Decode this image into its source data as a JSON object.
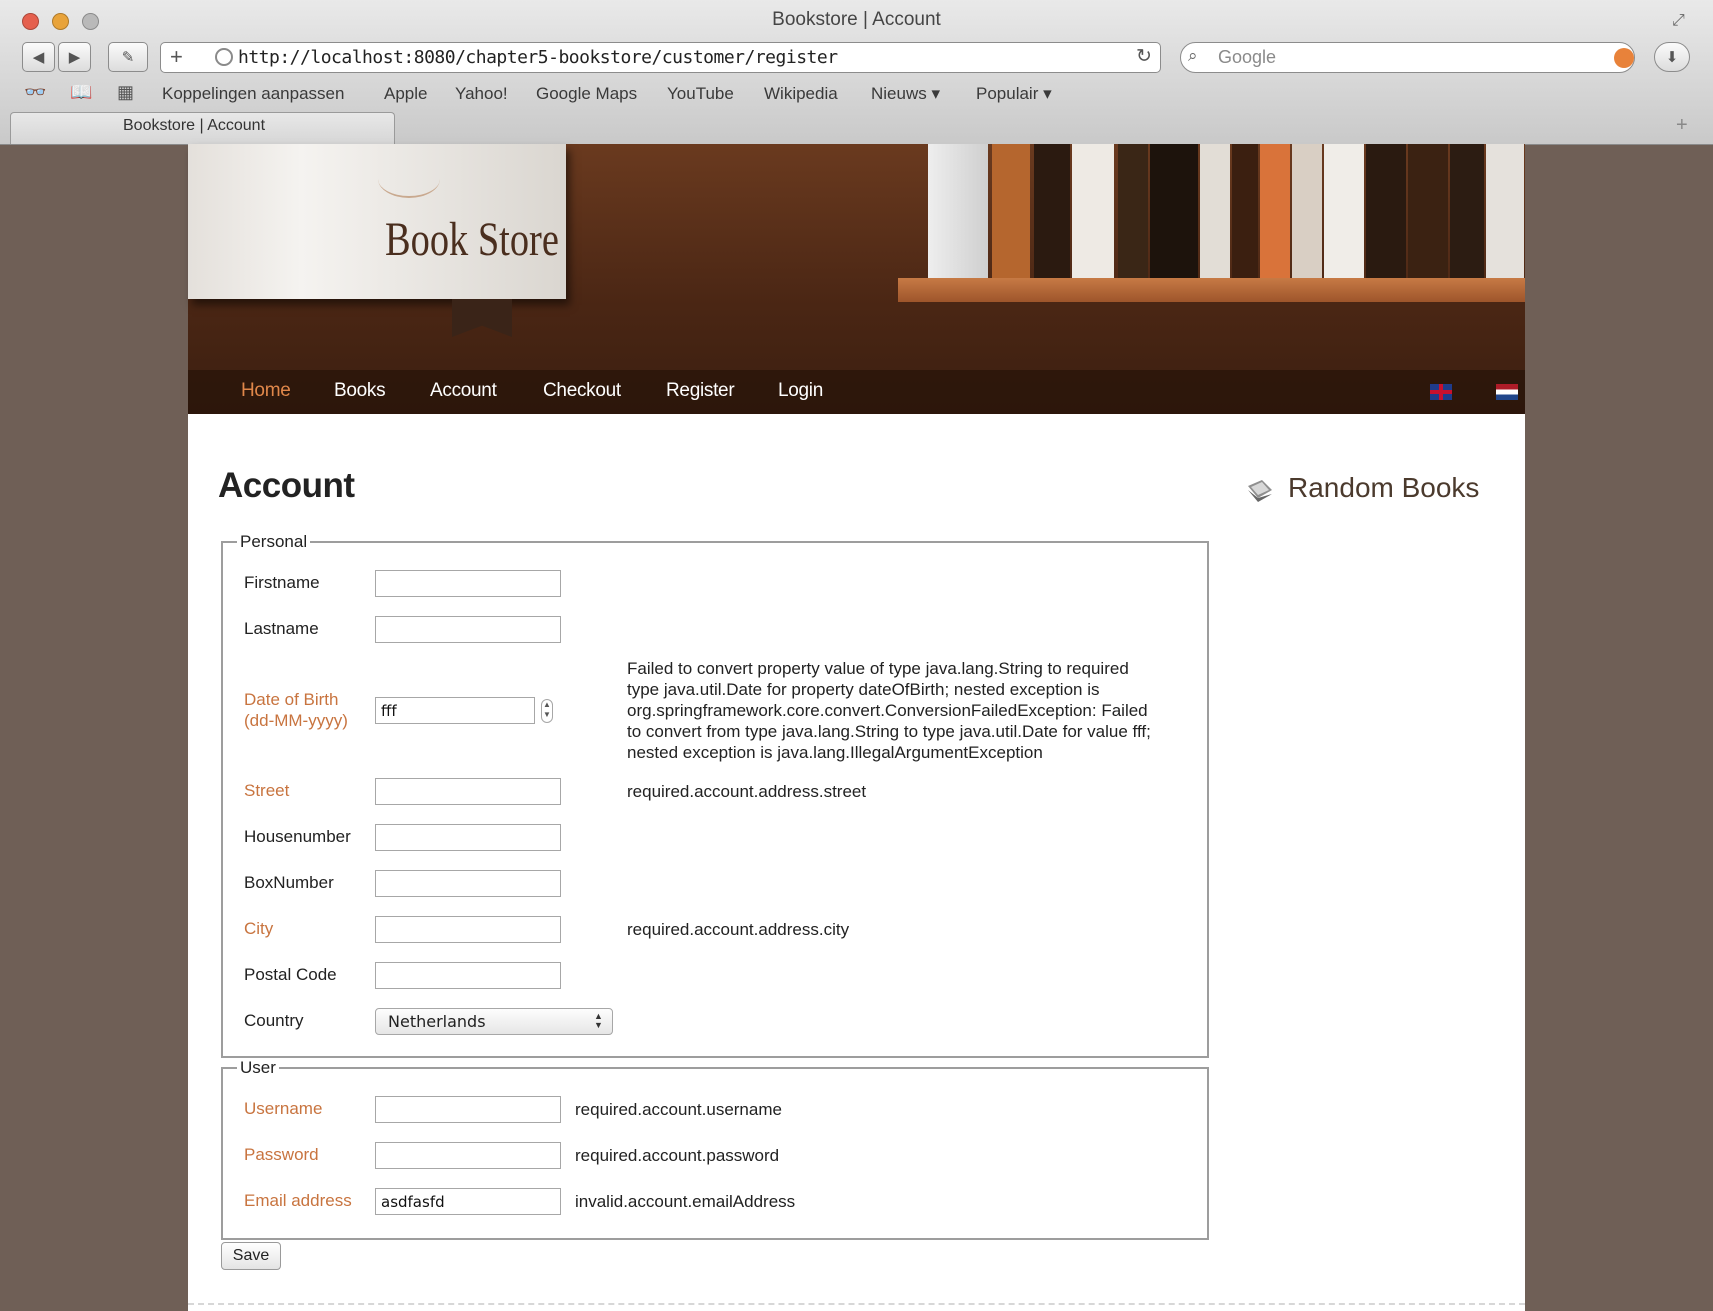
{
  "browser": {
    "window_title": "Bookstore | Account",
    "url": "http://localhost:8080/chapter5-bookstore/customer/register",
    "search_placeholder": "Google",
    "tab_title": "Bookstore | Account",
    "add_tab_label": "+",
    "new_button_label": "+",
    "bookmarks": [
      "Koppelingen aanpassen",
      "Apple",
      "Yahoo!",
      "Google Maps",
      "YouTube",
      "Wikipedia",
      "Nieuws ▾",
      "Populair ▾"
    ]
  },
  "header": {
    "logo": "Book Store"
  },
  "nav": {
    "items": [
      "Home",
      "Books",
      "Account",
      "Checkout",
      "Register",
      "Login"
    ],
    "active": "Home"
  },
  "page": {
    "title": "Account"
  },
  "sidebar": {
    "title": "Random Books"
  },
  "form": {
    "personal": {
      "legend": "Personal",
      "firstname_label": "Firstname",
      "lastname_label": "Lastname",
      "dob_label_1": "Date of Birth",
      "dob_label_2": "(dd-MM-yyyy)",
      "dob_value": "fff",
      "dob_error": [
        "Failed to convert property value of type java.lang.String to required",
        "type java.util.Date for property dateOfBirth; nested exception is",
        "org.springframework.core.convert.ConversionFailedException: Failed",
        "to convert from type java.lang.String to type java.util.Date for value fff;",
        "nested exception is java.lang.IllegalArgumentException"
      ],
      "street_label": "Street",
      "street_error": "required.account.address.street",
      "housenumber_label": "Housenumber",
      "boxnumber_label": "BoxNumber",
      "city_label": "City",
      "city_error": "required.account.address.city",
      "postal_label": "Postal Code",
      "country_label": "Country",
      "country_value": "Netherlands"
    },
    "user": {
      "legend": "User",
      "username_label": "Username",
      "username_error": "required.account.username",
      "password_label": "Password",
      "password_error": "required.account.password",
      "email_label": "Email address",
      "email_value": "asdfasfd",
      "email_error": "invalid.account.emailAddress"
    },
    "save_label": "Save"
  },
  "colors": {
    "error_label": "#c8743f",
    "nav_active": "#e0874a",
    "background": "#6f5f56"
  }
}
